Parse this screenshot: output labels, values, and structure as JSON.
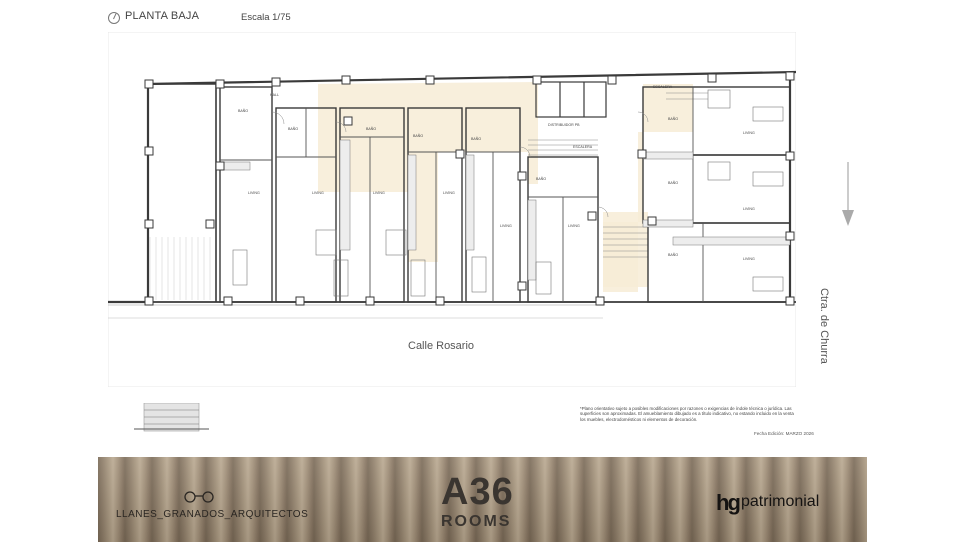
{
  "header": {
    "title": "PLANTA BAJA",
    "scale": "Escala 1/75"
  },
  "plan": {
    "street_main": "Calle Rosario",
    "street_side": "Ctra. de Churra",
    "labels": {
      "hall": "HALL",
      "distribuidor": "DISTRIBUIDOR PB",
      "escalera": "ESCALERA",
      "bano": "BAÑO",
      "living": "LIVING"
    },
    "colors": {
      "common_area": "#f7ecd6",
      "wall": "#3a3a3a",
      "line": "#888888"
    }
  },
  "legend": {
    "note": "*Plano orientativo sujeto a posibles modificaciones por razones o exigencias de índole técnica o jurídica. Las superficies son aproximadas. El amueblamiento dibujado es a título indicativo, no estando incluido en la venta los muebles, electrodomésticos ni elementos de decoración.",
    "edition": "Fecha Edición: MARZO 2026"
  },
  "footer": {
    "architect": "LLANES_GRANADOS_ARQUITECTOS",
    "brand_top": "A36",
    "brand_bottom": "ROOMS",
    "developer_mark": "hg",
    "developer_name": "patrimonial"
  }
}
